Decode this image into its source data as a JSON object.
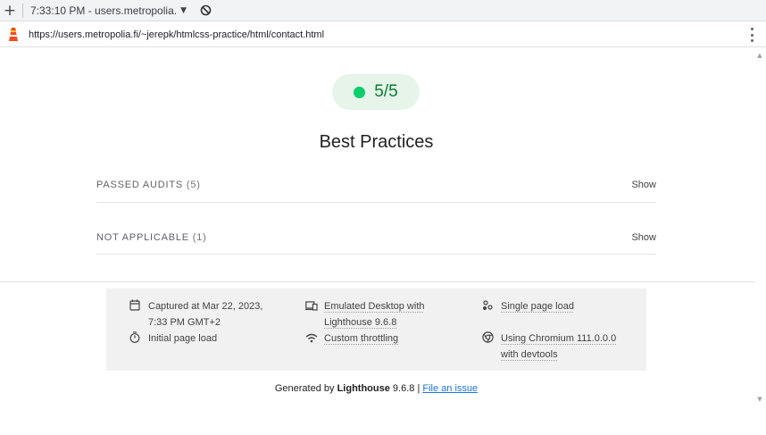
{
  "window": {
    "new_tab_glyph": "+",
    "tab_title": "7:33:10 PM - users.metropolia.",
    "caret_glyph": "▼"
  },
  "address_bar": {
    "url": "https://users.metropolia.fi/~jerepk/htmlcss-practice/html/contact.html"
  },
  "score": {
    "value": "5/5",
    "color": "#0cce6b"
  },
  "category": {
    "title": "Best Practices"
  },
  "audit_groups": [
    {
      "label": "PASSED AUDITS",
      "count": "(5)",
      "action": "Show"
    },
    {
      "label": "NOT APPLICABLE",
      "count": "(1)",
      "action": "Show"
    }
  ],
  "runtime_settings": [
    {
      "icon": "calendar-icon",
      "text": "Captured at Mar 22, 2023, 7:33 PM GMT+2"
    },
    {
      "icon": "devices-icon",
      "text": "Emulated Desktop with Lighthouse 9.6.8"
    },
    {
      "icon": "page-load-icon",
      "text": "Single page load"
    },
    {
      "icon": "stopwatch-icon",
      "text": "Initial page load"
    },
    {
      "icon": "network-icon",
      "text": "Custom throttling"
    },
    {
      "icon": "chrome-icon",
      "text": "Using Chromium 111.0.0.0 with devtools"
    }
  ],
  "footer": {
    "prefix": "Generated by",
    "product": "Lighthouse",
    "version": "9.6.8 |",
    "link": "File an issue"
  }
}
